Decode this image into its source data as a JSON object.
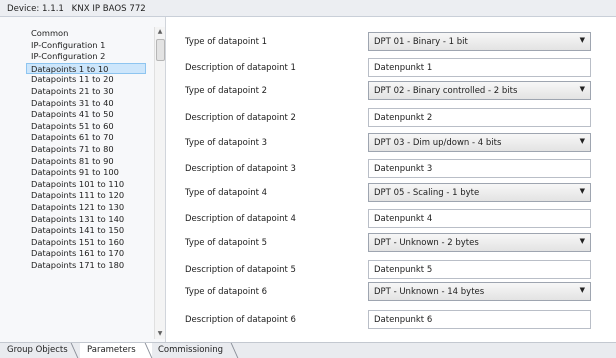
{
  "device": {
    "label": "Device:",
    "address": "1.1.1",
    "name": "KNX IP BAOS 772"
  },
  "sidebar": {
    "items": [
      "Common",
      "IP-Configuration 1",
      "IP-Configuration 2",
      "Datapoints 1 to 10",
      "Datapoints 11 to 20",
      "Datapoints 21 to 30",
      "Datapoints 31 to 40",
      "Datapoints 41 to 50",
      "Datapoints 51 to 60",
      "Datapoints 61 to 70",
      "Datapoints 71 to 80",
      "Datapoints 81 to 90",
      "Datapoints 91 to 100",
      "Datapoints 101 to 110",
      "Datapoints 111 to 120",
      "Datapoints 121 to 130",
      "Datapoints 131 to 140",
      "Datapoints 141 to 150",
      "Datapoints 151 to 160",
      "Datapoints 161 to 170",
      "Datapoints 171 to 180"
    ],
    "selected": "Datapoints 1 to 10"
  },
  "params": [
    {
      "label": "Type of datapoint 1",
      "kind": "select",
      "value": "DPT 01 - Binary - 1 bit"
    },
    {
      "label": "Description of datapoint 1",
      "kind": "text",
      "value": "Datenpunkt 1"
    },
    {
      "label": "Type of datapoint 2",
      "kind": "select",
      "value": "DPT 02 - Binary controlled - 2 bits"
    },
    {
      "label": "Description of datapoint 2",
      "kind": "text",
      "value": "Datenpunkt 2"
    },
    {
      "label": "Type of datapoint 3",
      "kind": "select",
      "value": "DPT 03 - Dim up/down - 4 bits"
    },
    {
      "label": "Description of datapoint 3",
      "kind": "text",
      "value": "Datenpunkt 3"
    },
    {
      "label": "Type of datapoint 4",
      "kind": "select",
      "value": "DPT 05 - Scaling - 1 byte"
    },
    {
      "label": "Description of datapoint 4",
      "kind": "text",
      "value": "Datenpunkt 4"
    },
    {
      "label": "Type of datapoint 5",
      "kind": "select",
      "value": "DPT - Unknown - 2 bytes"
    },
    {
      "label": "Description of datapoint 5",
      "kind": "text",
      "value": "Datenpunkt 5"
    },
    {
      "label": "Type of datapoint 6",
      "kind": "select",
      "value": "DPT - Unknown - 14 bytes"
    },
    {
      "label": "Description of datapoint 6",
      "kind": "text",
      "value": "Datenpunkt 6"
    }
  ],
  "tabs": [
    {
      "label": "Group Objects",
      "active": false
    },
    {
      "label": "Parameters",
      "active": true
    },
    {
      "label": "Commissioning",
      "active": false
    }
  ],
  "icons": {
    "scroll_up": "scroll-up-arrow-icon",
    "scroll_down": "scroll-down-arrow-icon",
    "dropdown": "dropdown-caret-icon"
  }
}
